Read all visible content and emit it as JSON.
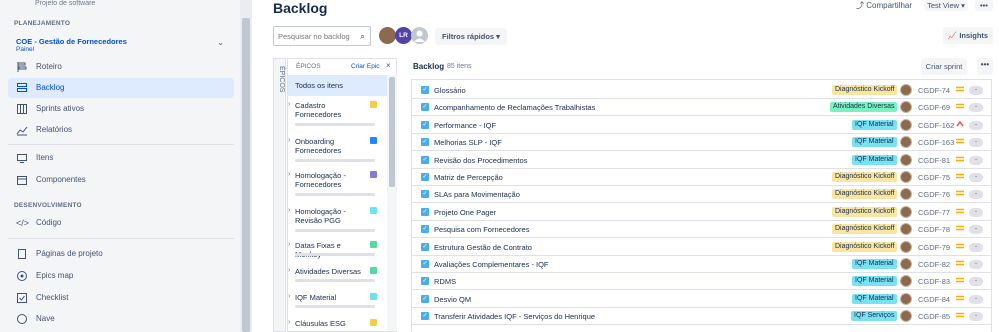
{
  "sidebar": {
    "project_type": "Projeto de software",
    "section_planning": "PLANEJAMENTO",
    "board": {
      "name": "COE - Gestão de Fornecedores",
      "sub": "Painel"
    },
    "planning_items": [
      {
        "label": "Roteiro",
        "icon": "roadmap-icon",
        "active": false
      },
      {
        "label": "Backlog",
        "icon": "backlog-icon",
        "active": true
      },
      {
        "label": "Sprints ativos",
        "icon": "board-icon",
        "active": false
      },
      {
        "label": "Relatórios",
        "icon": "reports-icon",
        "active": false
      }
    ],
    "middle_items": [
      {
        "label": "Itens",
        "icon": "issues-icon"
      },
      {
        "label": "Componentes",
        "icon": "components-icon"
      }
    ],
    "section_dev": "DESENVOLVIMENTO",
    "dev_items": [
      {
        "label": "Código",
        "icon": "code-icon"
      }
    ],
    "bottom_items": [
      {
        "label": "Páginas de projeto",
        "icon": "pages-icon"
      },
      {
        "label": "Epics map",
        "icon": "epics-map-icon"
      },
      {
        "label": "Checklist",
        "icon": "checklist-icon"
      },
      {
        "label": "Nave",
        "icon": "nave-icon"
      }
    ]
  },
  "header": {
    "title": "Backlog",
    "search_placeholder": "Pesquisar no backlog",
    "avatar_initials": "LR",
    "quick_filters": "Filtros rápidos ▾",
    "share": "Compartilhar",
    "view": "Test View ▾",
    "more": "•••",
    "insights": "Insights"
  },
  "epics_panel": {
    "vertical_tab": "ÉPICOS",
    "title": "ÉPICOS",
    "create": "Criar Epic",
    "close": "×",
    "all_items": "Todos os itens",
    "epics": [
      {
        "name": "Cadastro Fornecedores",
        "color": "#F5CD47"
      },
      {
        "name": "Onboarding Fornecedores",
        "color": "#2684FF"
      },
      {
        "name": "Homologação - Fornecedores",
        "color": "#8777D9"
      },
      {
        "name": "Homologação - Revisão PGG",
        "color": "#6CE3F0"
      },
      {
        "name": "Datas Fixas e Monkey",
        "color": "#57D9A3"
      },
      {
        "name": "Atividades Diversas",
        "color": "#57D9A3"
      },
      {
        "name": "IQF Material",
        "color": "#6CE3F0"
      },
      {
        "name": "Cláusulas ESG",
        "color": "#F5CD47"
      }
    ]
  },
  "backlog": {
    "title": "Backlog",
    "count": "85 itens",
    "create_sprint": "Criar sprint",
    "more": "•••",
    "items": [
      {
        "summary": "Glossário",
        "epic": "Diagnóstico Kickoff",
        "epic_color": "#F8E6A0",
        "key": "CGDF-74",
        "priority": "medium"
      },
      {
        "summary": "Acompanhamento de Reclamações Trabalhistas",
        "epic": "Atividades Diversas",
        "epic_color": "#79F2C0",
        "key": "CGDF-69",
        "priority": "medium"
      },
      {
        "summary": "Performance - IQF",
        "epic": "IQF Material",
        "epic_color": "#79E2F2",
        "key": "CGDF-162",
        "priority": "high"
      },
      {
        "summary": "Melhorias SLP - IQF",
        "epic": "IQF Material",
        "epic_color": "#79E2F2",
        "key": "CGDF-163",
        "priority": "medium"
      },
      {
        "summary": "Revisão dos Procedimentos",
        "epic": "IQF Material",
        "epic_color": "#79E2F2",
        "key": "CGDF-81",
        "priority": "medium"
      },
      {
        "summary": "Matriz de Percepção",
        "epic": "Diagnóstico Kickoff",
        "epic_color": "#F8E6A0",
        "key": "CGDF-75",
        "priority": "medium"
      },
      {
        "summary": "SLAs para Movimentação",
        "epic": "Diagnóstico Kickoff",
        "epic_color": "#F8E6A0",
        "key": "CGDF-76",
        "priority": "medium"
      },
      {
        "summary": "Projeto One Pager",
        "epic": "Diagnóstico Kickoff",
        "epic_color": "#F8E6A0",
        "key": "CGDF-77",
        "priority": "medium"
      },
      {
        "summary": "Pesquisa com Fornecedores",
        "epic": "Diagnóstico Kickoff",
        "epic_color": "#F8E6A0",
        "key": "CGDF-78",
        "priority": "medium"
      },
      {
        "summary": "Estrutura Gestão de Contrato",
        "epic": "Diagnóstico Kickoff",
        "epic_color": "#F8E6A0",
        "key": "CGDF-79",
        "priority": "medium"
      },
      {
        "summary": "Avaliações Complementares - IQF",
        "epic": "IQF Material",
        "epic_color": "#79E2F2",
        "key": "CGDF-82",
        "priority": "medium"
      },
      {
        "summary": "RDMS",
        "epic": "IQF Material",
        "epic_color": "#79E2F2",
        "key": "CGDF-83",
        "priority": "medium"
      },
      {
        "summary": "Desvio QM",
        "epic": "IQF Material",
        "epic_color": "#79E2F2",
        "key": "CGDF-84",
        "priority": "medium"
      },
      {
        "summary": "Transferir Atividades IQF - Serviços do Henrique",
        "epic": "IQF Serviços",
        "epic_color": "#79E2F2",
        "key": "CGDF-85",
        "priority": "medium"
      }
    ],
    "estimate": "-",
    "colors": {
      "medium": "#FFAB00",
      "high": "#FF5630"
    }
  }
}
